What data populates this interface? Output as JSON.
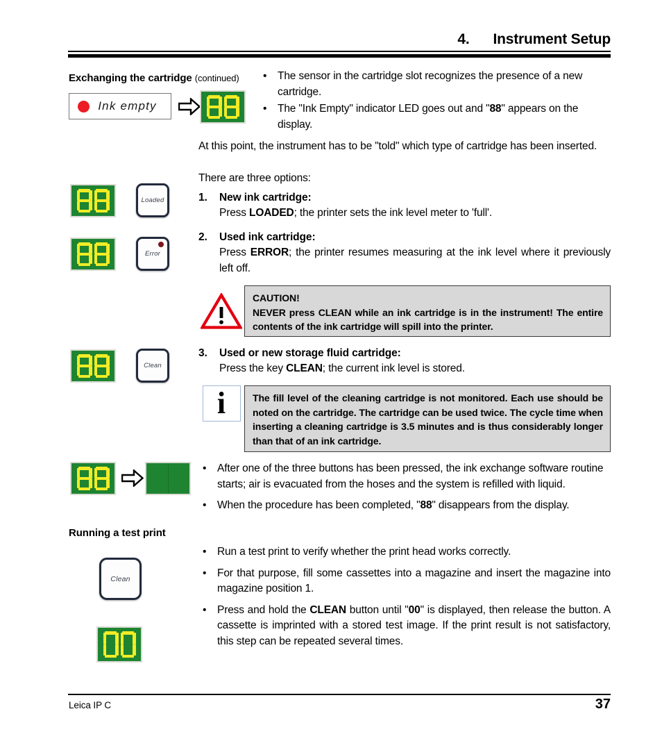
{
  "header": {
    "chapter_number": "4.",
    "chapter_title": "Instrument Setup"
  },
  "sidebar_labels": {
    "exchanging": "Exchanging the cartridge",
    "exchanging_continued": "(continued)",
    "running_test": "Running a test print"
  },
  "intro_bullets": [
    "The sensor in the cartridge slot recognizes the presence of a new cartridge.",
    "The \"Ink Empty\" indicator LED goes out and \"88\" appears on the display."
  ],
  "intro_bullet2_parts": {
    "before": "The \"Ink Empty\" indicator LED goes out and \"",
    "bold": "88",
    "after": "\" appears on the display."
  },
  "intro_paragraph": "At this point, the instrument has to be \"told\" which type of cartridge has been inserted.",
  "options_lead": "There are three options:",
  "options": [
    {
      "number": "1.",
      "title": "New ink cartridge:",
      "body_before": "Press ",
      "body_key": "LOADED",
      "body_after": "; the printer sets the ink level meter to 'full'."
    },
    {
      "number": "2.",
      "title": "Used ink cartridge:",
      "body_before": "Press ",
      "body_key": "ERROR",
      "body_after": "; the printer resumes measuring at the ink level where it previously left off."
    },
    {
      "number": "3.",
      "title": "Used or new storage fluid cartridge:",
      "body_before": "Press the key ",
      "body_key": "CLEAN",
      "body_after": "; the current ink level is stored."
    }
  ],
  "caution_box": {
    "heading": "CAUTION!",
    "text": "NEVER press CLEAN while an ink cartridge is in the instrument! The entire contents of the ink cartridge will spill into the printer.",
    "icon": "warning-triangle-icon",
    "triangle_color": "#e3000f",
    "background": "#d8d8d8"
  },
  "info_box": {
    "text": "The fill level of the cleaning cartridge is not monitored. Each use should be noted on the cartridge. The cartridge can be used twice. The cycle time when inserting a cleaning cartridge is 3.5 minutes and is thus considerably longer than that of an ink cartridge.",
    "icon": "info-i-icon",
    "background": "#d8d8d8"
  },
  "exchange_result_bullets": [
    {
      "text": "After one of the three buttons has been pressed, the ink exchange software routine starts; air is evacuated from the hoses and the system is refilled with liquid."
    },
    {
      "before": "When the procedure has been completed, \"",
      "bold": "88",
      "after": "\" disappears from the display."
    }
  ],
  "test_print_bullets": [
    {
      "text": "Run a test print to verify whether the print head works correctly."
    },
    {
      "text": "For that purpose, fill some cassettes into a magazine and insert the magazine into magazine position 1."
    },
    {
      "before": "Press and hold the ",
      "bold1": "CLEAN",
      "middle": " button until \"",
      "bold2": "00",
      "after": "\" is displayed, then release the button. A cassette is imprinted with a stored test image. If the print result is not satisfactory, this step can be repeated several times."
    }
  ],
  "led_indicator": {
    "label": "Ink  empty",
    "led_color": "#ec1c24",
    "icon": "ink-empty-led-icon"
  },
  "buttons": {
    "loaded": "Loaded",
    "error": "Error",
    "clean": "Clean",
    "error_led_color": "#7d1520"
  },
  "displays": {
    "value_88": "88",
    "value_00": "00",
    "value_blank": "",
    "segment_color": "#f2ec26",
    "screen_color": "#1e8431",
    "bezel_color": "#d9dcd4"
  },
  "arrow": {
    "icon": "block-arrow-right-icon"
  },
  "footer": {
    "product": "Leica IP C",
    "page_number": "37"
  }
}
